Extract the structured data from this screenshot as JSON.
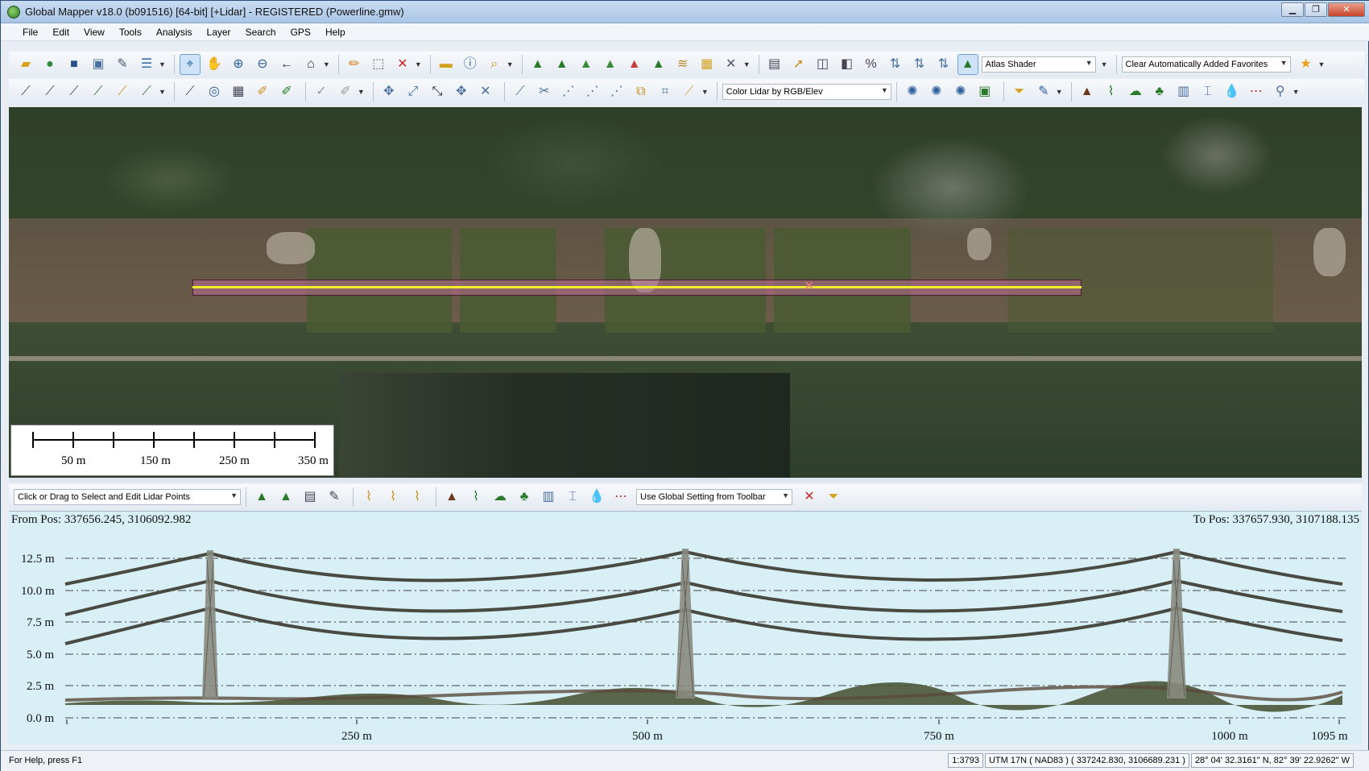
{
  "window": {
    "title": "Global Mapper v18.0 (b091516) [64-bit] [+Lidar] - REGISTERED (Powerline.gmw)",
    "minimize": "▁",
    "maximize": "❐",
    "close": "✕"
  },
  "menu": [
    "File",
    "Edit",
    "View",
    "Tools",
    "Analysis",
    "Layer",
    "Search",
    "GPS",
    "Help"
  ],
  "toolbar1": {
    "shader_select": "Atlas Shader",
    "favorites_select": "Clear Automatically Added Favorites"
  },
  "toolbar2": {
    "lidar_color_select": "Color Lidar by RGB/Elev"
  },
  "scalebar": {
    "labels": [
      "50 m",
      "150 m",
      "250 m",
      "350 m"
    ]
  },
  "profile_toolbar": {
    "mode_select": "Click or Drag to Select and Edit Lidar Points",
    "setting_select": "Use Global Setting from Toolbar"
  },
  "profile": {
    "from_pos": "From Pos: 337656.245, 3106092.982",
    "to_pos": "To Pos: 337657.930, 3107188.135",
    "y_ticks": [
      "12.5 m",
      "10.0 m",
      "7.5 m",
      "5.0 m",
      "2.5 m",
      "0.0 m"
    ],
    "x_ticks": [
      "250 m",
      "500 m",
      "750 m",
      "1000 m",
      "1095 m"
    ]
  },
  "status": {
    "help": "For Help, press F1",
    "scale": "1:3793",
    "projection": "UTM 17N ( NAD83 ) ( 337242.830, 3106689.231 )",
    "latlon": "28° 04' 32.3161\" N, 82° 39' 22.9262\" W"
  }
}
